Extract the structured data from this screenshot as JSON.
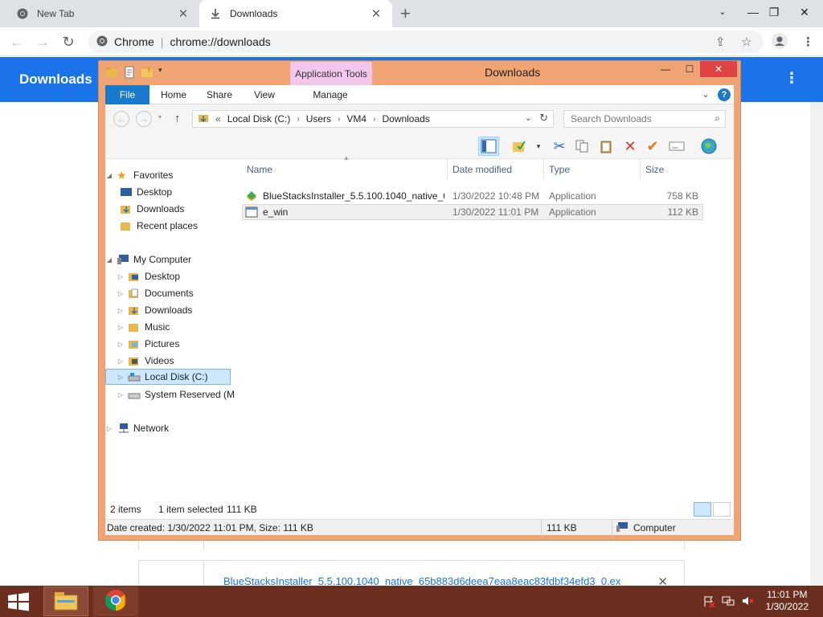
{
  "chrome": {
    "tabs": [
      {
        "label": "New Tab",
        "icon": "chrome-icon"
      },
      {
        "label": "Downloads",
        "icon": "download-icon"
      }
    ],
    "address": {
      "site_label": "Chrome",
      "url": "chrome://downloads"
    },
    "page_title": "Downloads",
    "download_item": {
      "filename": "BlueStacksInstaller_5.5.100.1040_native_65b883d6deea7eaa8eac83fdbf34efd3_0.ex"
    }
  },
  "explorer": {
    "title": "Downloads",
    "contextual_tab": "Application Tools",
    "ribbon_tabs": [
      "File",
      "Home",
      "Share",
      "View",
      "Manage"
    ],
    "breadcrumb": {
      "prefix": "«",
      "parts": [
        "Local Disk (C:)",
        "Users",
        "VM4",
        "Downloads"
      ]
    },
    "search_placeholder": "Search Downloads",
    "nav": {
      "favorites": {
        "label": "Favorites",
        "items": [
          "Desktop",
          "Downloads",
          "Recent places"
        ]
      },
      "computer": {
        "label": "My Computer",
        "items": [
          "Desktop",
          "Documents",
          "Downloads",
          "Music",
          "Pictures",
          "Videos",
          "Local Disk (C:)",
          "System Reserved (M"
        ]
      },
      "network": {
        "label": "Network"
      }
    },
    "columns": [
      "Name",
      "Date modified",
      "Type",
      "Size"
    ],
    "files": [
      {
        "name": "BlueStacksInstaller_5.5.100.1040_native_6...",
        "date": "1/30/2022 10:48 PM",
        "type": "Application",
        "size": "758 KB"
      },
      {
        "name": "e_win",
        "date": "1/30/2022 11:01 PM",
        "type": "Application",
        "size": "112 KB"
      }
    ],
    "status": {
      "count": "2 items",
      "selected": "1 item selected",
      "size": "111 KB"
    },
    "details": {
      "text": "Date created: 1/30/2022 11:01 PM, Size: 111 KB",
      "size": "111 KB",
      "location": "Computer"
    }
  },
  "taskbar": {
    "time": "11:01 PM",
    "date": "1/30/2022"
  }
}
